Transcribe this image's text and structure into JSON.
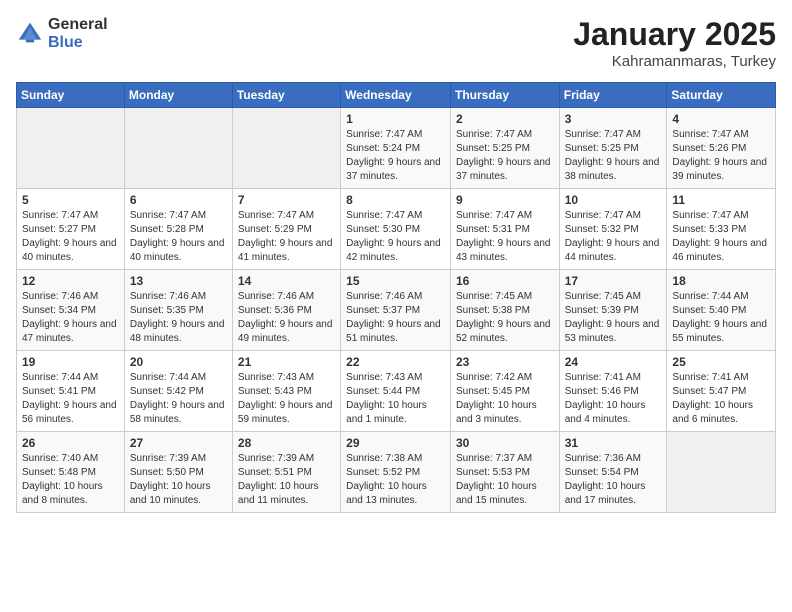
{
  "header": {
    "logo_general": "General",
    "logo_blue": "Blue",
    "title": "January 2025",
    "location": "Kahramanmaras, Turkey"
  },
  "weekdays": [
    "Sunday",
    "Monday",
    "Tuesday",
    "Wednesday",
    "Thursday",
    "Friday",
    "Saturday"
  ],
  "weeks": [
    [
      {
        "day": "",
        "content": ""
      },
      {
        "day": "",
        "content": ""
      },
      {
        "day": "",
        "content": ""
      },
      {
        "day": "1",
        "content": "Sunrise: 7:47 AM\nSunset: 5:24 PM\nDaylight: 9 hours and 37 minutes."
      },
      {
        "day": "2",
        "content": "Sunrise: 7:47 AM\nSunset: 5:25 PM\nDaylight: 9 hours and 37 minutes."
      },
      {
        "day": "3",
        "content": "Sunrise: 7:47 AM\nSunset: 5:25 PM\nDaylight: 9 hours and 38 minutes."
      },
      {
        "day": "4",
        "content": "Sunrise: 7:47 AM\nSunset: 5:26 PM\nDaylight: 9 hours and 39 minutes."
      }
    ],
    [
      {
        "day": "5",
        "content": "Sunrise: 7:47 AM\nSunset: 5:27 PM\nDaylight: 9 hours and 40 minutes."
      },
      {
        "day": "6",
        "content": "Sunrise: 7:47 AM\nSunset: 5:28 PM\nDaylight: 9 hours and 40 minutes."
      },
      {
        "day": "7",
        "content": "Sunrise: 7:47 AM\nSunset: 5:29 PM\nDaylight: 9 hours and 41 minutes."
      },
      {
        "day": "8",
        "content": "Sunrise: 7:47 AM\nSunset: 5:30 PM\nDaylight: 9 hours and 42 minutes."
      },
      {
        "day": "9",
        "content": "Sunrise: 7:47 AM\nSunset: 5:31 PM\nDaylight: 9 hours and 43 minutes."
      },
      {
        "day": "10",
        "content": "Sunrise: 7:47 AM\nSunset: 5:32 PM\nDaylight: 9 hours and 44 minutes."
      },
      {
        "day": "11",
        "content": "Sunrise: 7:47 AM\nSunset: 5:33 PM\nDaylight: 9 hours and 46 minutes."
      }
    ],
    [
      {
        "day": "12",
        "content": "Sunrise: 7:46 AM\nSunset: 5:34 PM\nDaylight: 9 hours and 47 minutes."
      },
      {
        "day": "13",
        "content": "Sunrise: 7:46 AM\nSunset: 5:35 PM\nDaylight: 9 hours and 48 minutes."
      },
      {
        "day": "14",
        "content": "Sunrise: 7:46 AM\nSunset: 5:36 PM\nDaylight: 9 hours and 49 minutes."
      },
      {
        "day": "15",
        "content": "Sunrise: 7:46 AM\nSunset: 5:37 PM\nDaylight: 9 hours and 51 minutes."
      },
      {
        "day": "16",
        "content": "Sunrise: 7:45 AM\nSunset: 5:38 PM\nDaylight: 9 hours and 52 minutes."
      },
      {
        "day": "17",
        "content": "Sunrise: 7:45 AM\nSunset: 5:39 PM\nDaylight: 9 hours and 53 minutes."
      },
      {
        "day": "18",
        "content": "Sunrise: 7:44 AM\nSunset: 5:40 PM\nDaylight: 9 hours and 55 minutes."
      }
    ],
    [
      {
        "day": "19",
        "content": "Sunrise: 7:44 AM\nSunset: 5:41 PM\nDaylight: 9 hours and 56 minutes."
      },
      {
        "day": "20",
        "content": "Sunrise: 7:44 AM\nSunset: 5:42 PM\nDaylight: 9 hours and 58 minutes."
      },
      {
        "day": "21",
        "content": "Sunrise: 7:43 AM\nSunset: 5:43 PM\nDaylight: 9 hours and 59 minutes."
      },
      {
        "day": "22",
        "content": "Sunrise: 7:43 AM\nSunset: 5:44 PM\nDaylight: 10 hours and 1 minute."
      },
      {
        "day": "23",
        "content": "Sunrise: 7:42 AM\nSunset: 5:45 PM\nDaylight: 10 hours and 3 minutes."
      },
      {
        "day": "24",
        "content": "Sunrise: 7:41 AM\nSunset: 5:46 PM\nDaylight: 10 hours and 4 minutes."
      },
      {
        "day": "25",
        "content": "Sunrise: 7:41 AM\nSunset: 5:47 PM\nDaylight: 10 hours and 6 minutes."
      }
    ],
    [
      {
        "day": "26",
        "content": "Sunrise: 7:40 AM\nSunset: 5:48 PM\nDaylight: 10 hours and 8 minutes."
      },
      {
        "day": "27",
        "content": "Sunrise: 7:39 AM\nSunset: 5:50 PM\nDaylight: 10 hours and 10 minutes."
      },
      {
        "day": "28",
        "content": "Sunrise: 7:39 AM\nSunset: 5:51 PM\nDaylight: 10 hours and 11 minutes."
      },
      {
        "day": "29",
        "content": "Sunrise: 7:38 AM\nSunset: 5:52 PM\nDaylight: 10 hours and 13 minutes."
      },
      {
        "day": "30",
        "content": "Sunrise: 7:37 AM\nSunset: 5:53 PM\nDaylight: 10 hours and 15 minutes."
      },
      {
        "day": "31",
        "content": "Sunrise: 7:36 AM\nSunset: 5:54 PM\nDaylight: 10 hours and 17 minutes."
      },
      {
        "day": "",
        "content": ""
      }
    ]
  ]
}
